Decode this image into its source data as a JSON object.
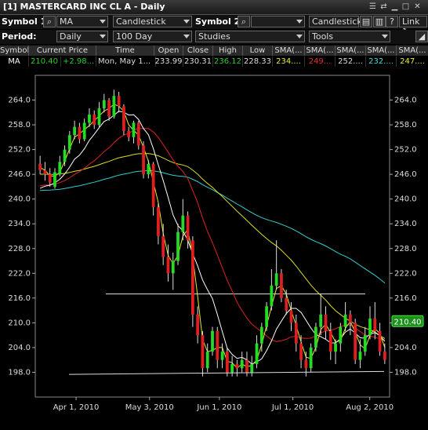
{
  "window": {
    "title": "[1] MASTERCARD INC CL A - Daily"
  },
  "toolbar": {
    "symbol1_label": "Symbol 1:",
    "symbol1_value": "MA",
    "chart_type": "Candlestick",
    "symbol2_label": "Symbol 2:",
    "symbol2_value": "",
    "chart_type2": "Candlestick",
    "help_label": "?",
    "link_label": "Link 1",
    "period_label": "Period:",
    "period_value": "Daily",
    "range_value": "100 Day",
    "studies_value": "Studies",
    "tools_value": "Tools"
  },
  "quote_table": {
    "headers": [
      "Symbol",
      "Current Price",
      "Time",
      "Open",
      "Close",
      "High",
      "Low",
      "SMA(...",
      "SMA(...",
      "SMA(...",
      "SMA(...",
      "SMA(..."
    ],
    "row": [
      "MA",
      "210.40",
      "+2.98...",
      "Mon, May 1...",
      "233.99",
      "230.31",
      "236.12",
      "228.33",
      "234....",
      "249...",
      "252....",
      "232....",
      "247...."
    ],
    "colors": {
      "price": "#2ecc2e",
      "change": "#2ecc2e",
      "high": "#2ecc2e",
      "sma1": "#e8e83a",
      "sma2": "#e53030",
      "sma4": "#44dddd",
      "sma5": "#e8e83a"
    }
  },
  "chart_data": {
    "type": "candlestick",
    "y_ticks": [
      "264.0",
      "258.0",
      "252.0",
      "246.0",
      "240.0",
      "234.0",
      "228.0",
      "222.0",
      "216.0",
      "210.0",
      "204.0",
      "198.0"
    ],
    "ylim": [
      192,
      270
    ],
    "x_ticks": [
      "Apr 1, 2010",
      "May 3, 2010",
      "Jun 1, 2010",
      "Jul 1, 2010",
      "Aug 2, 2010"
    ],
    "last_price_label": "210.40",
    "colors": {
      "up": "#22dd22",
      "down": "#e02020",
      "sma_white": "#ffffff",
      "sma_yellow": "#e8e832",
      "sma_red": "#dd2222",
      "sma_cyan": "#33cccc",
      "sma_olive": "#dddd22"
    },
    "candles": [
      [
        248.5,
        247,
        250.5,
        246
      ],
      [
        247,
        246,
        249,
        244.5
      ],
      [
        246,
        244,
        247.5,
        243
      ],
      [
        243,
        246.5,
        247.5,
        242.5
      ],
      [
        246,
        249,
        250.5,
        245.5
      ],
      [
        249,
        252,
        253,
        248
      ],
      [
        252,
        255.5,
        256.5,
        251
      ],
      [
        255.5,
        257.5,
        259,
        254.5
      ],
      [
        257.5,
        254.5,
        258.5,
        253.5
      ],
      [
        254.5,
        258.5,
        259.5,
        254
      ],
      [
        258.5,
        260.5,
        262,
        257.5
      ],
      [
        260.5,
        258,
        261.5,
        257
      ],
      [
        258,
        262,
        263.5,
        257.5
      ],
      [
        262,
        264,
        265.5,
        261
      ],
      [
        264,
        260,
        264.5,
        259
      ],
      [
        260,
        265,
        266.5,
        259.5
      ],
      [
        265,
        262.5,
        266,
        261
      ],
      [
        262.5,
        256.5,
        263,
        255.5
      ],
      [
        256.5,
        255,
        257.5,
        254
      ],
      [
        255,
        258.5,
        259,
        253.5
      ],
      [
        258.5,
        253,
        259,
        252
      ],
      [
        253,
        246,
        254,
        245
      ],
      [
        246,
        248.5,
        249.5,
        245
      ],
      [
        248.5,
        238,
        249,
        236
      ],
      [
        238,
        231,
        239,
        229
      ],
      [
        231,
        226,
        234,
        224
      ],
      [
        226,
        222,
        229,
        220
      ],
      [
        222,
        225,
        227,
        218
      ],
      [
        225,
        232,
        234,
        224
      ],
      [
        232,
        236,
        240,
        230
      ],
      [
        236,
        230,
        237,
        228
      ],
      [
        230,
        212,
        231,
        209
      ],
      [
        212,
        207,
        214,
        205
      ],
      [
        207,
        199,
        208,
        197
      ],
      [
        199,
        203,
        205,
        198
      ],
      [
        203,
        208,
        209,
        202
      ],
      [
        208,
        201,
        209,
        199
      ],
      [
        201,
        203,
        205,
        199
      ],
      [
        203,
        198,
        204,
        197
      ],
      [
        198,
        200,
        202,
        197
      ],
      [
        200,
        199,
        201,
        197
      ],
      [
        199,
        201,
        203,
        198
      ],
      [
        201,
        198,
        203,
        197
      ],
      [
        198,
        200,
        202,
        197
      ],
      [
        200,
        205,
        207,
        199
      ],
      [
        205,
        209,
        210,
        203
      ],
      [
        209,
        214,
        215,
        208
      ],
      [
        214,
        219,
        223,
        213
      ],
      [
        219,
        222,
        230,
        218
      ],
      [
        222,
        216,
        223,
        215
      ],
      [
        216,
        213,
        218,
        212
      ],
      [
        213,
        210,
        215,
        208
      ],
      [
        210,
        205,
        212,
        203
      ],
      [
        205,
        201,
        207,
        199
      ],
      [
        201,
        199,
        203,
        197
      ],
      [
        199,
        204,
        205,
        198
      ],
      [
        204,
        209,
        210,
        203
      ],
      [
        209,
        212,
        217,
        207
      ],
      [
        212,
        208,
        214,
        206
      ],
      [
        208,
        203,
        210,
        201
      ],
      [
        203,
        205,
        206,
        200
      ],
      [
        205,
        209,
        210,
        203
      ],
      [
        209,
        212,
        215,
        208
      ],
      [
        212,
        210,
        213,
        207
      ],
      [
        210,
        201,
        211,
        200
      ],
      [
        201,
        203,
        206,
        199
      ],
      [
        203,
        207,
        209,
        202
      ],
      [
        207,
        211,
        214,
        206
      ],
      [
        211,
        208,
        215,
        206
      ],
      [
        208,
        203,
        210,
        202
      ],
      [
        203,
        201,
        205,
        200
      ]
    ]
  }
}
